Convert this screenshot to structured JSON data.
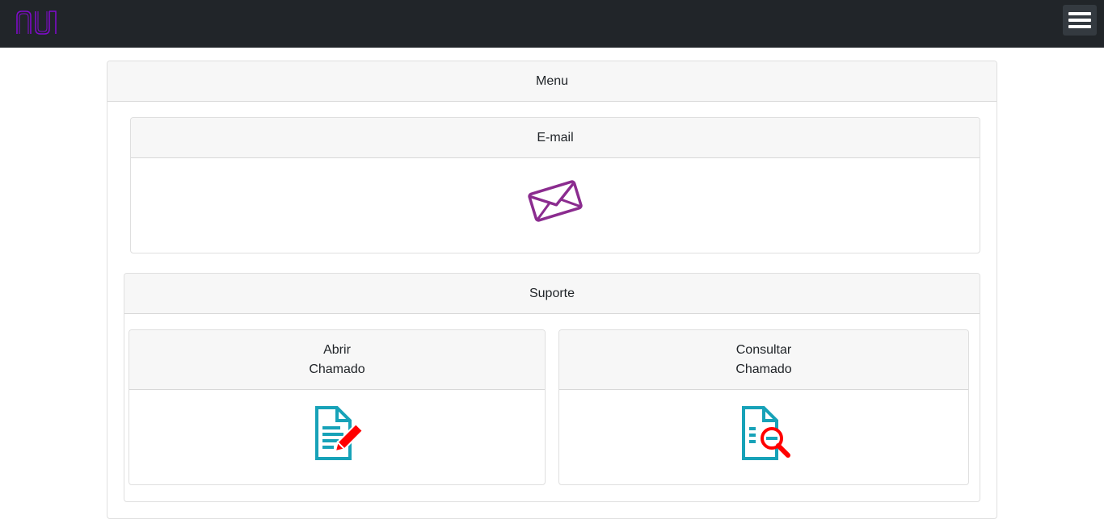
{
  "navbar": {
    "logo_icon": "nu-logo-icon",
    "menu_icon": "hamburger-menu-icon"
  },
  "menu": {
    "title": "Menu"
  },
  "email": {
    "title": "E-mail",
    "icon": "envelope-icon"
  },
  "suporte": {
    "title": "Suporte",
    "abrir": {
      "line1": "Abrir",
      "line2": "Chamado",
      "icon": "document-edit-icon"
    },
    "consultar": {
      "line1": "Consultar",
      "line2": "Chamado",
      "icon": "document-search-icon"
    }
  },
  "colors": {
    "navbar_bg": "#212529",
    "logo": "#820ad1",
    "envelope": "#8b2c8f",
    "doc_teal": "#17a2b8",
    "accent_red": "#ff0000"
  }
}
